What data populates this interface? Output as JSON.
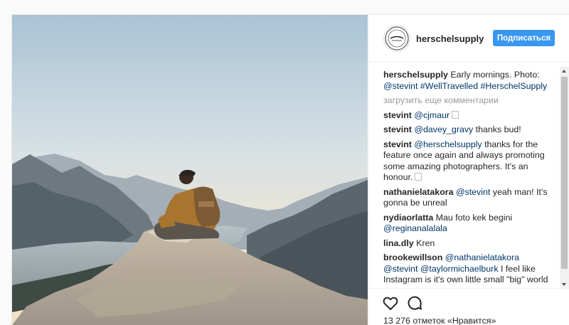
{
  "post": {
    "username": "herschelsupply",
    "follow_label": "Подписаться",
    "caption": {
      "user": "herschelsupply",
      "text": " Early mornings. Photo: ",
      "link": "@stevint #WellTravelled #HerschelSupply"
    },
    "load_more": "загрузить еще комментарии",
    "comments": [
      {
        "user": "stevint",
        "link": "@cjmaur",
        "text": "",
        "has_emoji": true
      },
      {
        "user": "stevint",
        "link": "@davey_gravy",
        "text": " thanks bud!",
        "has_emoji": false
      },
      {
        "user": "stevint",
        "link": "@herschelsupply",
        "text": " thanks for the feature once again and always promoting some amazing photographers. It's an honour.",
        "has_emoji": true
      },
      {
        "user": "nathanielatakora",
        "link": "@stevint",
        "text": " yeah man! It's gonna be unreal",
        "has_emoji": false
      },
      {
        "user": "nydiaorlatta",
        "link": "",
        "text": " Mau foto kek begini ",
        "link2": "@reginanalalala",
        "has_emoji": false
      },
      {
        "user": "lina.dly",
        "link": "",
        "text": " Kren",
        "has_emoji": false
      },
      {
        "user": "brookewillson",
        "link": "@nathanielatakora @stevint @taylormichaelburk",
        "text": " I feel like Instagram is it's own little small \"big\" world we all no everybody lol happy thanksgiving yall",
        "has_emoji": false
      }
    ],
    "likes": "13 276 отметок «Нравится»",
    "icons": {
      "like": "heart-icon",
      "comment": "comment-icon"
    }
  }
}
